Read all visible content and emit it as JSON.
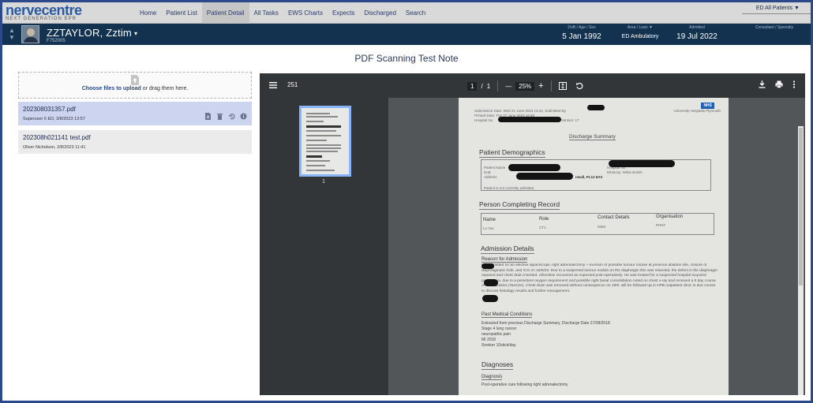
{
  "app": {
    "brand": "nervecentre",
    "tagline": "NEXT GENERATION EPR"
  },
  "nav": {
    "items": [
      {
        "label": "Home"
      },
      {
        "label": "Patient List"
      },
      {
        "label": "Patient Detail",
        "active": true
      },
      {
        "label": "All Tasks"
      },
      {
        "label": "EWS Charts"
      },
      {
        "label": "Expects"
      },
      {
        "label": "Discharged"
      },
      {
        "label": "Search"
      }
    ],
    "patients_menu": "ED All Patients ▼"
  },
  "patient": {
    "name": "ZZTAYLOR, Zztim",
    "caret": "▾",
    "id": "F752005",
    "dob_label": "DoB / Age / Sex",
    "dob": "5 Jan 1992",
    "area_label": "Area / Loan ▼",
    "area": "ED Ambulatory",
    "admitted_label": "Admitted",
    "admitted": "19 Jul 2022",
    "consultant_label": "Consultant / Specialty"
  },
  "note": {
    "title": "PDF Scanning Test Note"
  },
  "upload": {
    "bold": "Choose files to upload",
    "rest": " or drag them here."
  },
  "files": [
    {
      "name": "202308031357.pdf",
      "meta": "Superuser 5 ED, 3/8/2023 13:57",
      "selected": true
    },
    {
      "name": "202308h021141 test.pdf",
      "meta": "Oliver Nicholson, 2/8/2023 11:41",
      "selected": false
    }
  ],
  "viewer": {
    "doc_label": "251",
    "page_current": "1",
    "page_sep": "/",
    "page_total": "1",
    "zoom": "25%",
    "zoom_out": "—",
    "zoom_in": "+",
    "thumb_page": "1"
  },
  "pdf": {
    "header_line1": "Submission Date: Wed 21 June 2023 13:44, Submitted By",
    "header_line2": "Printed Date: Tue 27 June 2023 16:58",
    "header_line3": "Hospital No",
    "header_version": "Version: 17",
    "nhs": "NHS",
    "trust": "University Hospitals Plymouth",
    "doc_title": "Discharge Summary",
    "demographics_heading": "Patient Demographics",
    "demo_label1": "Patient Name",
    "demo_label2": "DoB",
    "demo_label3": "Address",
    "demo_hospital": "Hospital No",
    "demo_ethnicity": "Ethnicity: White British",
    "demo_address_tail": "nwall, PL12 6AX",
    "demo_note": "Patient is not currently admitted.",
    "person_heading": "Person Completing Record",
    "person_cols": [
      "Name",
      "Role",
      "Contact Details",
      "Organisation"
    ],
    "person_vals": [
      "Lu Yao",
      "CT1",
      "0258",
      "PHNT"
    ],
    "admission_heading": "Admission Details",
    "reason_heading": "Reason for Admission",
    "reason_text": "was admitted for an elective laparoscopic right adrenalectomy + excision of possible tumour nodule at previous ablation site, closure of diaphragmatic hole, and ICG on 16/6/23. Due to a suspected tumour nodule on the diaphragm this was resected, the defect in the diaphragm repaired and chest drain inserted. otherwise recovered as expected post-operatively. He was treated for a suspected hospital acquired pneumonia, due to a persistent oxygen requirement and possible right basal consolidation noted on chest x-ray and received a 5 day course of IV antibiotics (Tazocin). Chest drain was removed without consequence on 19/6. will be followed up in HPB outpatient clinic in due course to discuss histology results and further management.",
    "pmh_heading": "Past Medical Conditions",
    "pmh_lines": [
      "Extracted from previous Discharge Summary, Discharge Date 27/08/2018",
      "Stage 4 lung cancer",
      "neuropathic pain",
      "MI 2018",
      "Smoker 10stick/day"
    ],
    "diagnoses_heading": "Diagnoses",
    "diagnosis_heading": "Diagnosis",
    "diagnosis_text": "Post-operative care following right adrenalectomy"
  }
}
